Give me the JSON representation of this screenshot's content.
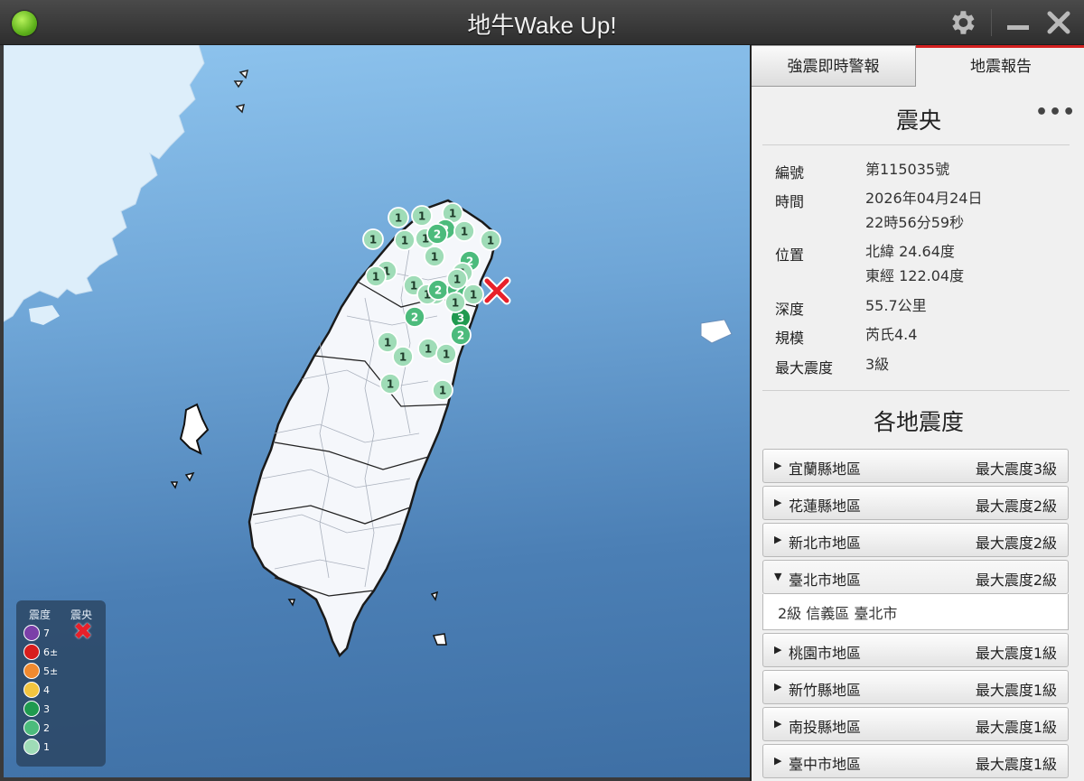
{
  "window": {
    "title": "地牛Wake Up!"
  },
  "tabs": [
    {
      "label": "強震即時警報",
      "active": false
    },
    {
      "label": "地震報告",
      "active": true
    }
  ],
  "epicenter": {
    "heading": "震央",
    "more": "•••",
    "rows": [
      {
        "label": "編號",
        "value": "第115035號"
      },
      {
        "label": "時間",
        "value": "2026年04月24日",
        "value2": "22時56分59秒"
      },
      {
        "label": "位置",
        "value": "北緯 24.64度",
        "value2": "東經 122.04度"
      },
      {
        "label": "深度",
        "value": "55.7公里"
      },
      {
        "label": "規模",
        "value": "芮氏4.4"
      },
      {
        "label": "最大震度",
        "value": "3級"
      }
    ]
  },
  "intensity": {
    "heading": "各地震度",
    "regions": [
      {
        "name": "宜蘭縣地區",
        "max": "最大震度3級",
        "expanded": false
      },
      {
        "name": "花蓮縣地區",
        "max": "最大震度2級",
        "expanded": false
      },
      {
        "name": "新北市地區",
        "max": "最大震度2級",
        "expanded": false
      },
      {
        "name": "臺北市地區",
        "max": "最大震度2級",
        "expanded": true,
        "detail": "2級  信義區  臺北市"
      },
      {
        "name": "桃園市地區",
        "max": "最大震度1級",
        "expanded": false
      },
      {
        "name": "新竹縣地區",
        "max": "最大震度1級",
        "expanded": false
      },
      {
        "name": "南投縣地區",
        "max": "最大震度1級",
        "expanded": false
      },
      {
        "name": "臺中市地區",
        "max": "最大震度1級",
        "expanded": false
      }
    ]
  },
  "legend": {
    "intensity_header": "震度",
    "epicenter_header": "震央",
    "epicenter_mark": "✖",
    "levels": [
      {
        "label": "7",
        "color": "#7b3fa8"
      },
      {
        "label": "6±",
        "color": "#d81e1e"
      },
      {
        "label": "5±",
        "color": "#f08a30"
      },
      {
        "label": "4",
        "color": "#f2c540"
      },
      {
        "label": "3",
        "color": "#1f9a4f"
      },
      {
        "label": "2",
        "color": "#4cbb7c"
      },
      {
        "label": "1",
        "color": "#9fdcb7"
      }
    ]
  },
  "stations": [
    {
      "value": "1"
    },
    {
      "value": "1"
    },
    {
      "value": "1"
    },
    {
      "value": "2"
    },
    {
      "value": "1"
    },
    {
      "value": "1"
    },
    {
      "value": "2"
    },
    {
      "value": "1"
    },
    {
      "value": "1"
    },
    {
      "value": "1"
    },
    {
      "value": "1"
    },
    {
      "value": "1"
    },
    {
      "value": "2"
    },
    {
      "value": "1"
    },
    {
      "value": "1"
    },
    {
      "value": "1"
    },
    {
      "value": "1"
    },
    {
      "value": "1"
    },
    {
      "value": "2"
    },
    {
      "value": "2"
    },
    {
      "value": "1"
    },
    {
      "value": "1"
    },
    {
      "value": "2"
    },
    {
      "value": "3"
    },
    {
      "value": "2"
    },
    {
      "value": "1"
    },
    {
      "value": "1"
    },
    {
      "value": "1"
    },
    {
      "value": "1"
    },
    {
      "value": "1"
    },
    {
      "value": "1"
    },
    {
      "value": "1"
    },
    {
      "value": "1"
    }
  ],
  "colors": {
    "level1": "#9fdcb7",
    "level2": "#4cbb7c",
    "level3": "#1f9a4f",
    "epicenter": "#e8202a",
    "active_tab_accent": "#d32020"
  }
}
